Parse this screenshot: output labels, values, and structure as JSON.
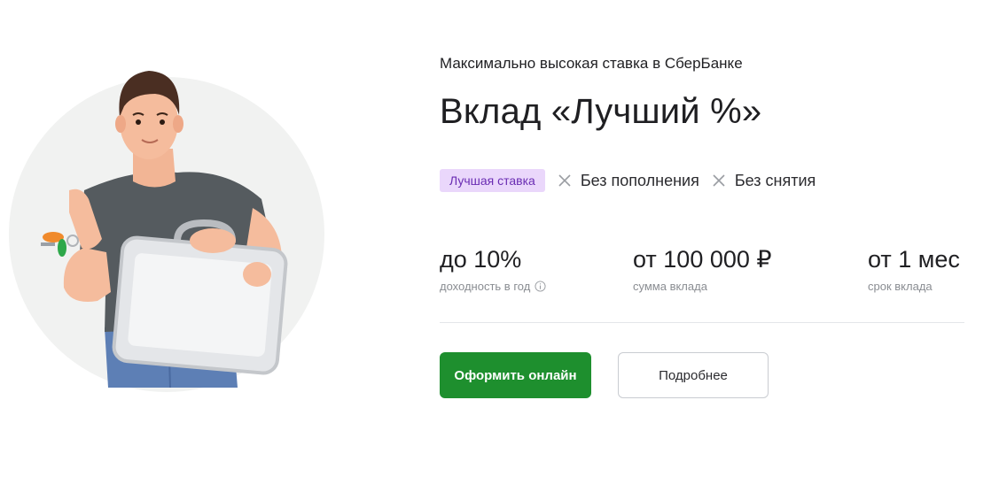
{
  "hero": {
    "subtitle": "Максимально высокая ставка в СберБанке",
    "title": "Вклад «Лучший %»"
  },
  "tags": {
    "badge": "Лучшая ставка",
    "items": [
      {
        "label": "Без пополнения",
        "icon": "x-icon"
      },
      {
        "label": "Без снятия",
        "icon": "x-icon"
      }
    ]
  },
  "stats": [
    {
      "value": "до 10%",
      "label": "доходность в год",
      "icon": "info-icon"
    },
    {
      "value": "от 100 000 ₽",
      "label": "сумма вклада"
    },
    {
      "value": "от 1 мес",
      "label": "срок вклада"
    }
  ],
  "buttons": {
    "primary": "Оформить онлайн",
    "secondary": "Подробнее"
  },
  "colors": {
    "primary_button": "#1e8f2e",
    "badge_bg": "#ead7fb",
    "badge_text": "#6a2db3",
    "circle_bg": "#f1f2f1"
  }
}
